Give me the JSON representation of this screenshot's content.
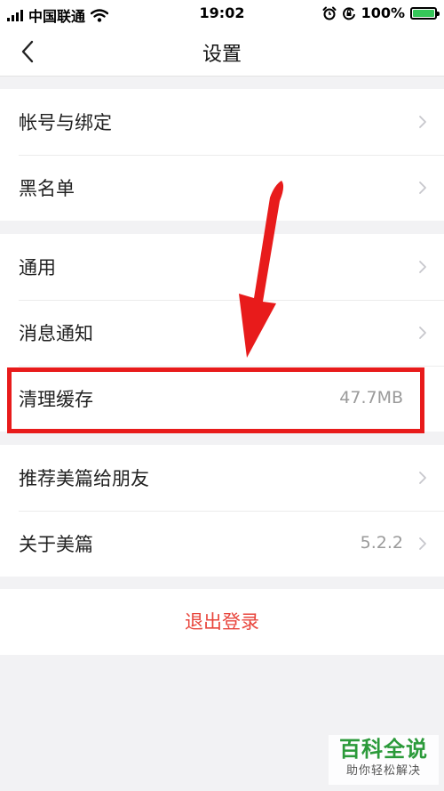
{
  "status_bar": {
    "carrier": "中国联通",
    "time": "19:02",
    "battery": "100%"
  },
  "nav": {
    "title": "设置"
  },
  "groups": [
    {
      "items": [
        {
          "label": "帐号与绑定"
        },
        {
          "label": "黑名单"
        }
      ]
    },
    {
      "items": [
        {
          "label": "通用"
        },
        {
          "label": "消息通知"
        },
        {
          "label": "清理缓存",
          "value": "47.7MB"
        }
      ]
    },
    {
      "items": [
        {
          "label": "推荐美篇给朋友"
        },
        {
          "label": "关于美篇",
          "value": "5.2.2"
        }
      ]
    }
  ],
  "logout": {
    "label": "退出登录"
  },
  "watermark": {
    "title": "百科全说",
    "subtitle": "助你轻松解决"
  },
  "colors": {
    "accent_red": "#e8453c",
    "annotation_red": "#e81b1b",
    "watermark_green": "#2b9a3a"
  }
}
